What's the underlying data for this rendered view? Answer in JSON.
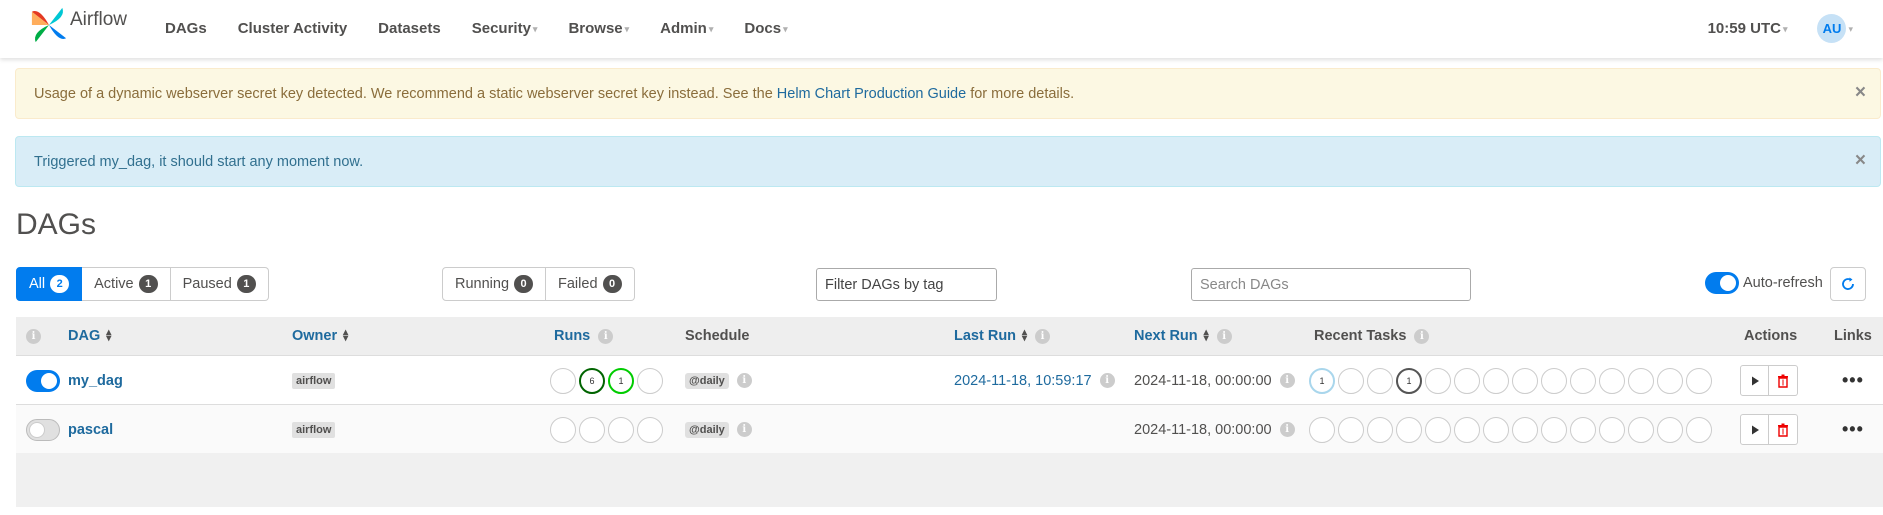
{
  "navbar": {
    "brand": "Airflow",
    "items": [
      {
        "label": "DAGs"
      },
      {
        "label": "Cluster Activity"
      },
      {
        "label": "Datasets"
      },
      {
        "label": "Security"
      },
      {
        "label": "Browse"
      },
      {
        "label": "Admin"
      },
      {
        "label": "Docs"
      }
    ],
    "clock": "10:59 UTC",
    "avatar": "AU"
  },
  "alerts": {
    "warning": {
      "text_before": "Usage of a dynamic webserver secret key detected. We recommend a static webserver secret key instead. See the",
      "link": "Helm Chart Production Guide",
      "text_after": "for more details.",
      "close": "×"
    },
    "info": {
      "text": "Triggered my_dag, it should start any moment now.",
      "close": "×"
    }
  },
  "page_title": "DAGs",
  "filters": {
    "status": [
      {
        "label": "All",
        "count": "2"
      },
      {
        "label": "Active",
        "count": "1"
      },
      {
        "label": "Paused",
        "count": "1"
      }
    ],
    "run_state": [
      {
        "label": "Running",
        "count": "0"
      },
      {
        "label": "Failed",
        "count": "0"
      }
    ],
    "tag_placeholder": "Filter DAGs by tag",
    "search_placeholder": "Search DAGs",
    "auto_refresh": "Auto-refresh"
  },
  "table": {
    "headers": {
      "dag": "DAG",
      "owner": "Owner",
      "runs": "Runs",
      "schedule": "Schedule",
      "last_run": "Last Run",
      "next_run": "Next Run",
      "recent_tasks": "Recent Tasks",
      "actions": "Actions",
      "links": "Links"
    },
    "rows": [
      {
        "dag_id": "my_dag",
        "enabled": true,
        "owner": "airflow",
        "runs": [
          "",
          "6",
          "1",
          ""
        ],
        "schedule": "@daily",
        "last_run": "2024-11-18, 10:59:17",
        "next_run": "2024-11-18, 00:00:00",
        "recent_tasks": [
          "1",
          "",
          "",
          "1",
          "",
          "",
          "",
          "",
          "",
          "",
          "",
          "",
          "",
          ""
        ],
        "links": "•••"
      },
      {
        "dag_id": "pascal",
        "enabled": false,
        "owner": "airflow",
        "runs": [
          "",
          "",
          "",
          ""
        ],
        "schedule": "@daily",
        "last_run": "",
        "next_run": "2024-11-18, 00:00:00",
        "recent_tasks": [
          "",
          "",
          "",
          "",
          "",
          "",
          "",
          "",
          "",
          "",
          "",
          "",
          "",
          ""
        ],
        "links": "•••"
      }
    ]
  },
  "colors": {
    "primary": "#017cee",
    "link": "#1e6a9e",
    "success": "#00cc00",
    "queued": "#006400"
  }
}
